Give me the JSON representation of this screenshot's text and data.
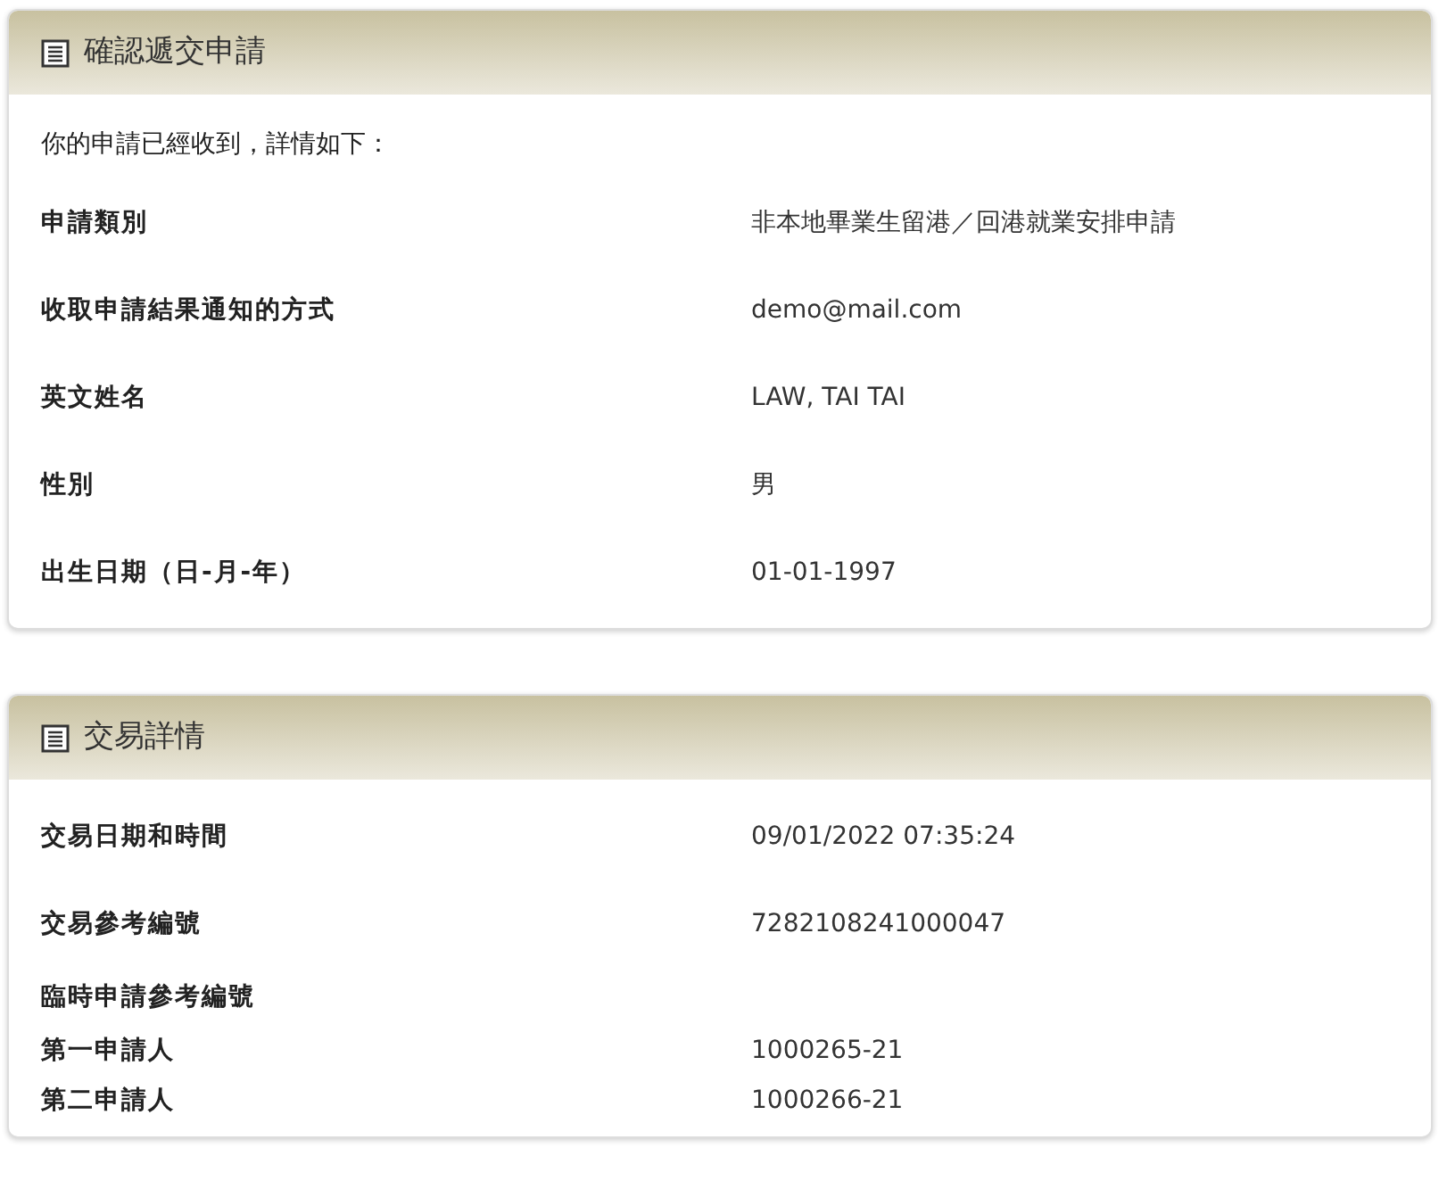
{
  "panels": [
    {
      "title": "確認遞交申請",
      "intro": "你的申請已經收到，詳情如下：",
      "rows": [
        {
          "kind": "field",
          "label": "申請類別",
          "value": "非本地畢業生留港／回港就業安排申請"
        },
        {
          "kind": "field",
          "label": "收取申請結果通知的方式",
          "value": "demo@mail.com"
        },
        {
          "kind": "field",
          "label": "英文姓名",
          "value": "LAW, TAI TAI"
        },
        {
          "kind": "field",
          "label": "性別",
          "value": "男"
        },
        {
          "kind": "field",
          "label": "出生日期（日-月-年）",
          "value": "01-01-1997"
        }
      ]
    },
    {
      "title": "交易詳情",
      "rows": [
        {
          "kind": "field",
          "label": "交易日期和時間",
          "value": "09/01/2022 07:35:24"
        },
        {
          "kind": "field",
          "label": "交易參考編號",
          "value": "7282108241000047"
        },
        {
          "kind": "group",
          "label": "臨時申請參考編號"
        },
        {
          "kind": "sub",
          "label": "第一申請人",
          "value": "1000265-21"
        },
        {
          "kind": "sub",
          "label": "第二申請人",
          "value": "1000266-21"
        }
      ]
    }
  ]
}
